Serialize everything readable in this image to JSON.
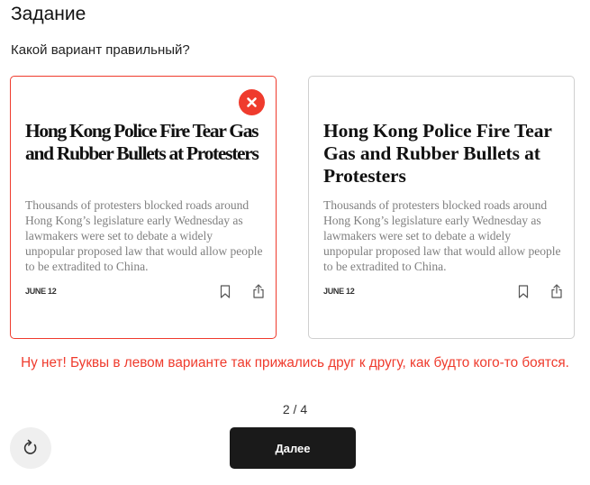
{
  "page": {
    "title": "Задание",
    "question": "Какой вариант правильный?"
  },
  "options": [
    {
      "headline": "Hong Kong Police Fire Tear Gas and Rubber Bullets at Protesters",
      "body": "Thousands of protesters blocked roads around Hong Kong’s legislature early Wednesday as lawmakers were set to debate a widely unpopular proposed law that would allow people to be extradited to China.",
      "date": "JUNE 12",
      "state": "wrong",
      "badge_icon": "close-icon"
    },
    {
      "headline": "Hong Kong Police Fire Tear Gas and Rubber Bullets at Protesters",
      "body": "Thousands of protesters blocked roads around Hong Kong’s legislature early Wednesday as lawmakers were set to debate a widely unpopular proposed law that would allow people to be extradited to China.",
      "date": "JUNE 12",
      "state": "default"
    }
  ],
  "feedback": {
    "text": "Ну нет! Буквы в левом варианте так прижались друг к другу, как будто кого-то боятся.",
    "color": "#ef3b2d"
  },
  "progress": {
    "current": 2,
    "total": 4,
    "label": "2 / 4"
  },
  "controls": {
    "next_label": "Далее",
    "retry_icon": "refresh-icon"
  },
  "colors": {
    "error": "#ef3b2d",
    "button_dark": "#1a1a1a",
    "retry_bg": "#efefef"
  }
}
